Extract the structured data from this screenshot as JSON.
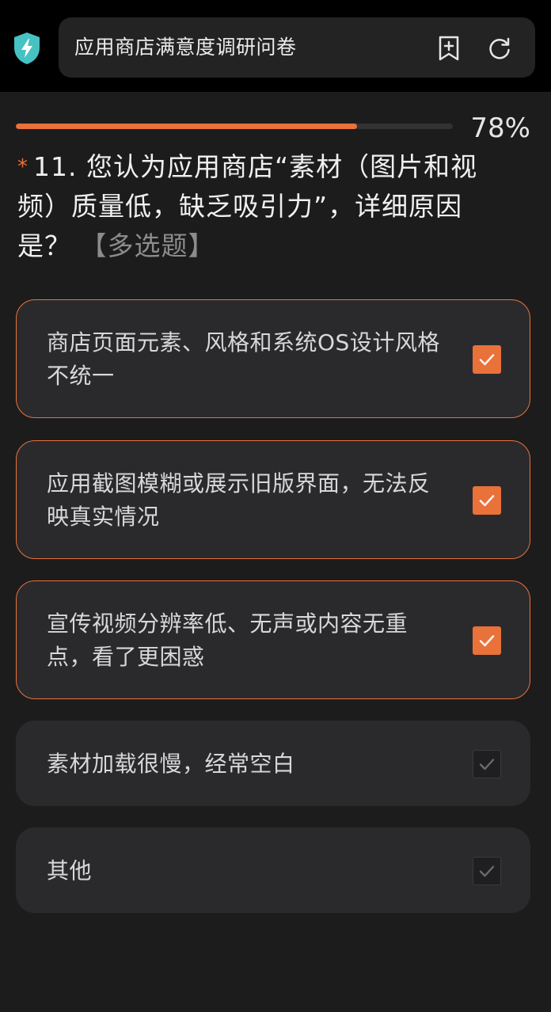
{
  "browser": {
    "page_title": "应用商店满意度调研问卷",
    "shield_icon": "shield-lightning-icon",
    "bookmark_icon": "add-bookmark-icon",
    "refresh_icon": "refresh-icon"
  },
  "progress": {
    "value": 0.78,
    "text": "78%"
  },
  "question": {
    "required_mark": "*",
    "text": "11. 您认为应用商店“素材（图片和视频）质量低，缺乏吸引力”，详细原因是？",
    "type_label": "【多选题】"
  },
  "options": [
    {
      "label": "商店页面元素、风格和系统OS设计风格不统一",
      "checked": true
    },
    {
      "label": "应用截图模糊或展示旧版界面，无法反映真实情况",
      "checked": true
    },
    {
      "label": "宣传视频分辨率低、无声或内容无重点，看了更困惑",
      "checked": true
    },
    {
      "label": "素材加载很慢，经常空白",
      "checked": false
    },
    {
      "label": "其他",
      "checked": false
    }
  ],
  "colors": {
    "accent": "#e9713a",
    "background": "#1c1c1c",
    "card": "#2a2a2d"
  }
}
